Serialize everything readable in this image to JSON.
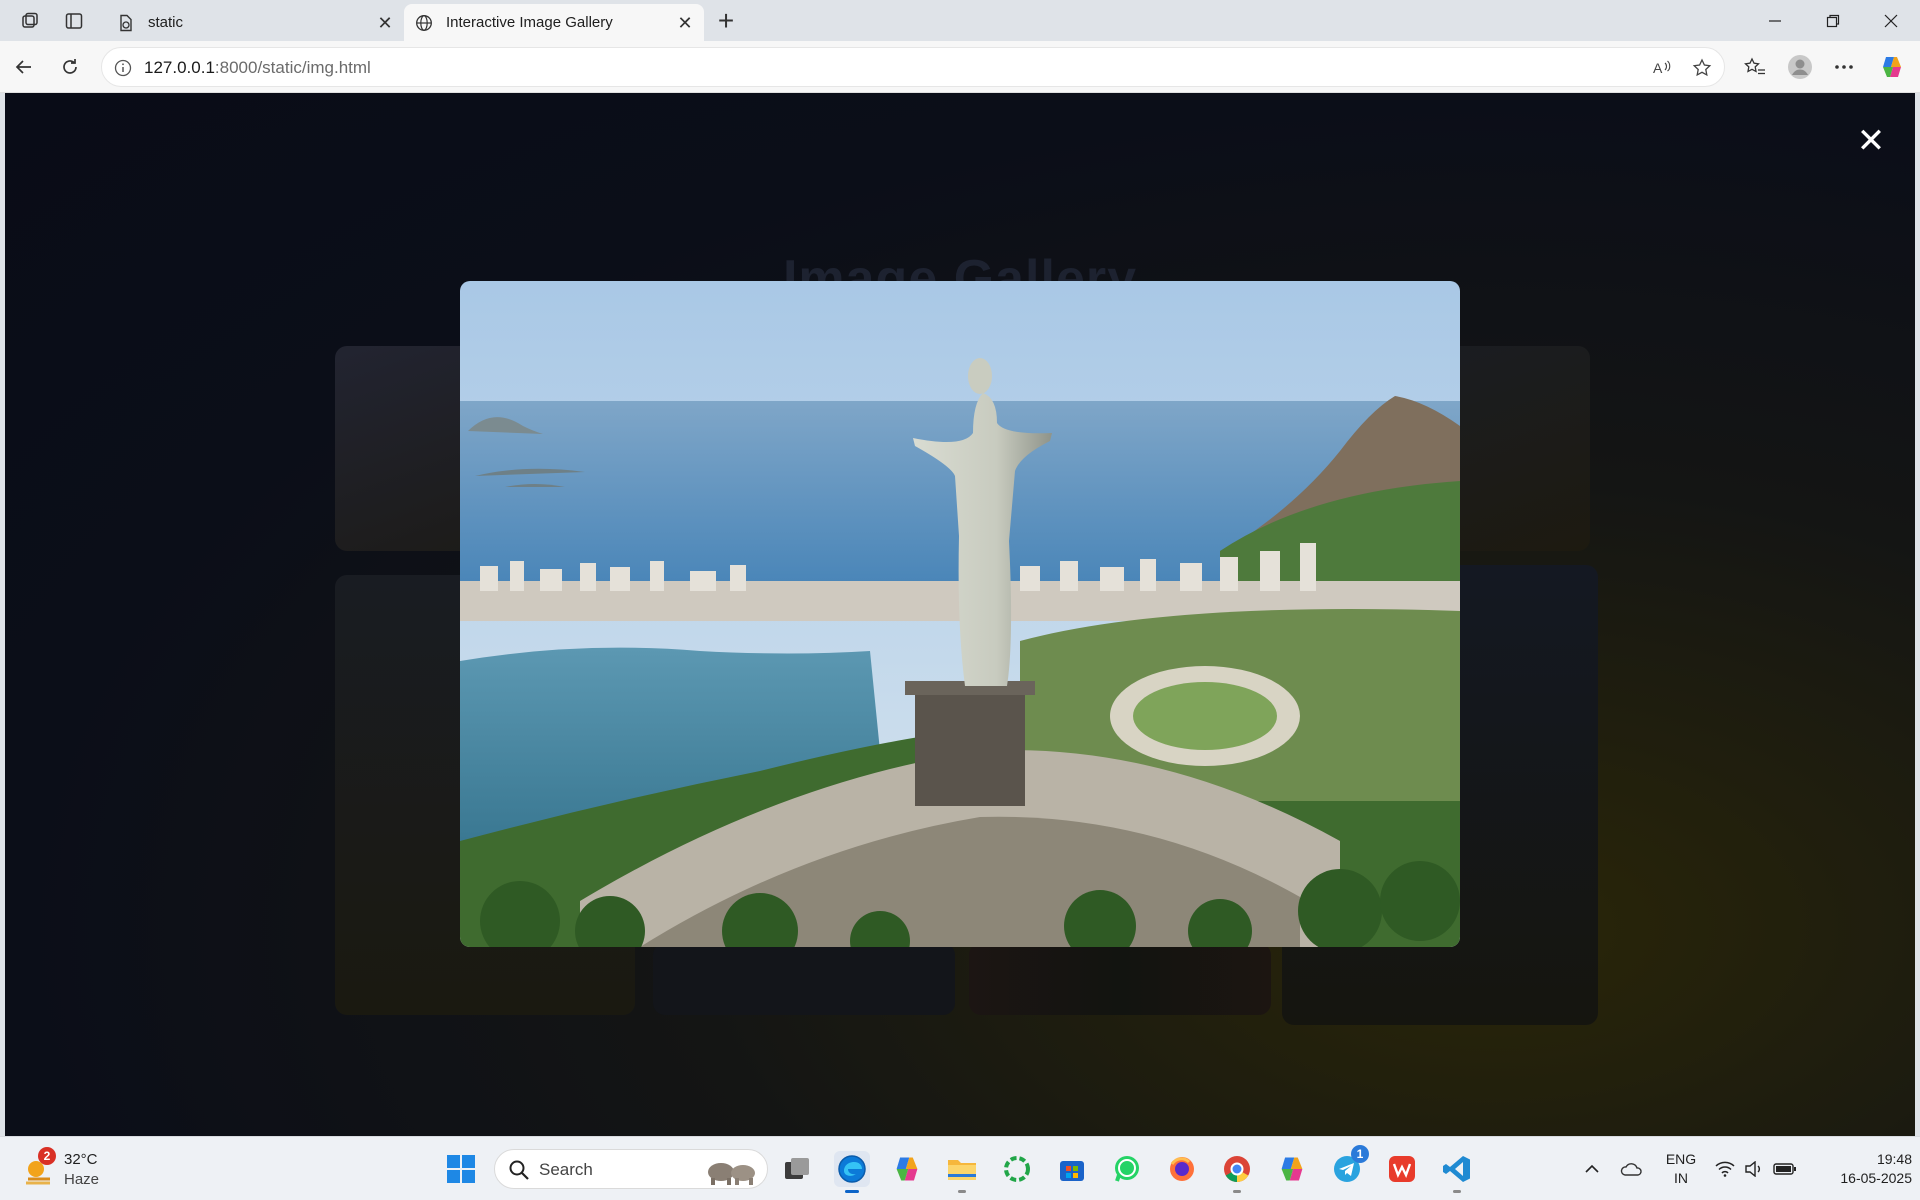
{
  "browser": {
    "tabs": [
      {
        "label": "static",
        "active": false
      },
      {
        "label": "Interactive Image Gallery",
        "active": true
      }
    ],
    "address": {
      "host": "127.0.0.1",
      "rest": ":8000/static/img.html"
    }
  },
  "page": {
    "title": "Image Gallery",
    "lightbox": {
      "close_glyph": "✕",
      "subject": "Christ the Redeemer statue overlooking Rio de Janeiro"
    },
    "background_colors": {
      "top": "#090c17",
      "bottom_right": "#2a2608"
    }
  },
  "taskbar": {
    "weather": {
      "temp": "32°C",
      "condition": "Haze",
      "badge": "2"
    },
    "search_placeholder": "Search",
    "apps": [
      "start-icon",
      "search-icon",
      "task-view-icon",
      "edge-icon",
      "copilot-icon",
      "file-explorer-icon",
      "refresh-app-icon",
      "store-icon",
      "whatsapp-icon",
      "firefox-icon",
      "chrome-icon",
      "m365-icon",
      "telegram-icon",
      "wps-icon",
      "vscode-icon"
    ],
    "telegram_badge": "1",
    "tray": {
      "lang_line1": "ENG",
      "lang_line2": "IN",
      "time": "19:48",
      "date": "16-05-2025"
    }
  }
}
